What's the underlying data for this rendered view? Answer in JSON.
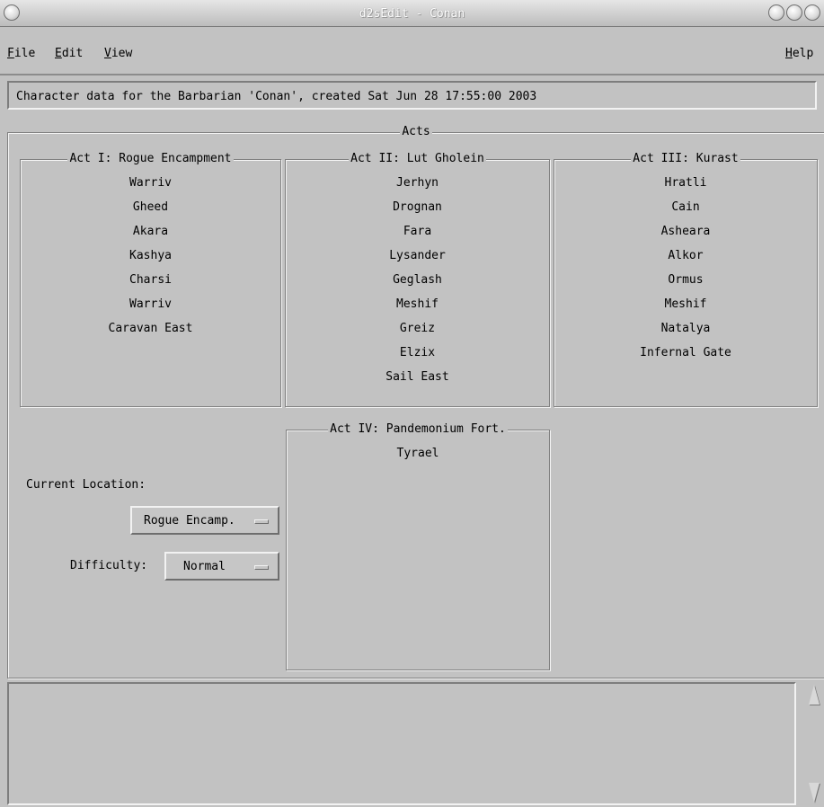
{
  "window": {
    "title": "d2sEdit - Conan"
  },
  "menu": {
    "file": {
      "mnemonic": "F",
      "rest": "ile"
    },
    "edit": {
      "mnemonic": "E",
      "rest": "dit"
    },
    "view": {
      "mnemonic": "V",
      "rest": "iew"
    },
    "help": {
      "mnemonic": "H",
      "rest": "elp"
    }
  },
  "info": "Character data for the Barbarian 'Conan', created Sat Jun 28 17:55:00 2003",
  "acts": {
    "label": "Acts",
    "act1": {
      "title": "Act I: Rogue Encampment",
      "npcs": [
        "Warriv",
        "Gheed",
        "Akara",
        "Kashya",
        "Charsi",
        "Warriv",
        "Caravan East"
      ]
    },
    "act2": {
      "title": "Act II: Lut Gholein",
      "npcs": [
        "Jerhyn",
        "Drognan",
        "Fara",
        "Lysander",
        "Geglash",
        "Meshif",
        "Greiz",
        "Elzix",
        "Sail East"
      ]
    },
    "act3": {
      "title": "Act III: Kurast",
      "npcs": [
        "Hratli",
        "Cain",
        "Asheara",
        "Alkor",
        "Ormus",
        "Meshif",
        "Natalya",
        "Infernal Gate"
      ]
    },
    "act4": {
      "title": "Act IV: Pandemonium Fort.",
      "npcs": [
        "Tyrael"
      ]
    }
  },
  "location": {
    "label": "Current Location:",
    "value": "Rogue Encamp."
  },
  "difficulty": {
    "label": "Difficulty:",
    "value": "Normal"
  },
  "output": {
    "text": ""
  },
  "colors": {
    "background": "#c2c2c2",
    "text": "#000000",
    "title_text": "#ffffff"
  }
}
